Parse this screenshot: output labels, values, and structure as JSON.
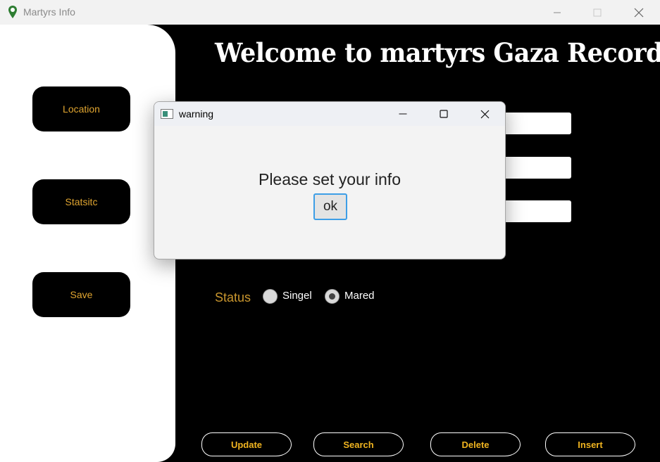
{
  "window": {
    "title": "Martyrs Info",
    "icon": "map-pin-icon"
  },
  "sidebar": {
    "buttons": [
      "Location",
      "Statsitc",
      "Save"
    ]
  },
  "main": {
    "welcome": "Welcome to  martyrs Gaza Records",
    "status_label": "Status",
    "status_options": [
      "Singel",
      "Mared"
    ],
    "status_selected": "Mared"
  },
  "actions": [
    "Update",
    "Search",
    "Delete",
    "Insert"
  ],
  "dialog": {
    "title": "warning",
    "message": "Please set your info",
    "ok_label": "ok"
  },
  "colors": {
    "accent": "#e0a530",
    "action_text": "#f0b420",
    "background": "#000000",
    "dialog_focus": "#3d9ee6"
  }
}
